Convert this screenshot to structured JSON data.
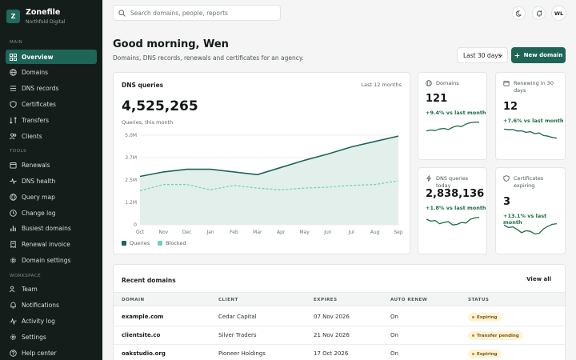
{
  "brand": {
    "logo": "Z",
    "name": "Zonefile",
    "org": "Northfold Digital"
  },
  "sidebar": {
    "sections": [
      {
        "title": "MAIN",
        "items": [
          {
            "label": "Overview",
            "icon": "grid-icon",
            "active": true
          },
          {
            "label": "Domains",
            "icon": "globe-icon"
          },
          {
            "label": "DNS records",
            "icon": "list-icon"
          },
          {
            "label": "Certificates",
            "icon": "shield-icon"
          },
          {
            "label": "Transfers",
            "icon": "transfer-icon"
          },
          {
            "label": "Clients",
            "icon": "users-icon"
          }
        ]
      },
      {
        "title": "TOOLS",
        "items": [
          {
            "label": "Renewals",
            "icon": "calendar-icon"
          },
          {
            "label": "DNS health",
            "icon": "pulse-icon"
          },
          {
            "label": "Query map",
            "icon": "globe-icon"
          },
          {
            "label": "Change log",
            "icon": "clock-icon"
          },
          {
            "label": "Busiest domains",
            "icon": "bars-icon"
          },
          {
            "label": "Renewal invoice",
            "icon": "receipt-icon"
          },
          {
            "label": "Domain settings",
            "icon": "gear-icon"
          }
        ]
      },
      {
        "title": "WORKSPACE",
        "items": [
          {
            "label": "Team",
            "icon": "users-icon"
          },
          {
            "label": "Notifications",
            "icon": "bell-icon"
          },
          {
            "label": "Activity log",
            "icon": "activity-icon"
          },
          {
            "label": "Settings",
            "icon": "gear-icon"
          },
          {
            "label": "Help center",
            "icon": "help-icon"
          }
        ]
      }
    ]
  },
  "header": {
    "search_placeholder": "Search domains, people, reports",
    "avatar_initials": "WL",
    "greeting": "Good morning, Wen",
    "subtitle": "Domains, DNS records, renewals and certificates for an agency.",
    "period": "Last 30 days",
    "new_button": "New domain"
  },
  "dns_card": {
    "title": "DNS queries",
    "range": "Last 12 months",
    "total": "4,525,265",
    "caption": "Queries, this month"
  },
  "chart_data": {
    "type": "area",
    "categories": [
      "Oct",
      "Nov",
      "Dec",
      "Jan",
      "Feb",
      "Mar",
      "Apr",
      "May",
      "Jun",
      "Jul",
      "Aug",
      "Sep"
    ],
    "yticks": [
      "0",
      "1.2M",
      "2.5M",
      "3.7M",
      "5.0M"
    ],
    "ylim": [
      0,
      5000000
    ],
    "series": [
      {
        "name": "Queries",
        "color": "#1e6558",
        "values": [
          2700000,
          2950000,
          3100000,
          3100000,
          2950000,
          2800000,
          3200000,
          3600000,
          3950000,
          4350000,
          4650000,
          4950000
        ]
      },
      {
        "name": "Blocked",
        "color": "#6fd3b6",
        "values": [
          1900000,
          2250000,
          2250000,
          1950000,
          2200000,
          2050000,
          1950000,
          2050000,
          2100000,
          2200000,
          2250000,
          2450000
        ]
      }
    ],
    "grid": true,
    "legend": "bottom-left"
  },
  "stats": [
    {
      "label": "Domains",
      "value": "121",
      "delta": "+9.4% vs last month",
      "icon": "globe-icon",
      "spark": [
        0.2,
        0.28,
        0.24,
        0.36,
        0.4,
        0.32,
        0.5,
        0.6,
        0.55,
        0.75,
        0.85,
        0.9,
        0.88
      ]
    },
    {
      "label": "Renewing in 30 days",
      "value": "12",
      "delta": "+7.6% vs last month",
      "icon": "calendar-icon",
      "spark": [
        0.85,
        0.8,
        0.82,
        0.7,
        0.72,
        0.6,
        0.65,
        0.5,
        0.55,
        0.35,
        0.3,
        0.2,
        0.15
      ]
    },
    {
      "label": "DNS queries today",
      "value": "2,838,136",
      "delta": "+1.8% vs last month",
      "icon": "bolt-icon",
      "spark": [
        0.75,
        0.6,
        0.65,
        0.4,
        0.5,
        0.55,
        0.3,
        0.35,
        0.5,
        0.45,
        0.75,
        0.85,
        0.9
      ]
    },
    {
      "label": "Certificates expiring",
      "value": "3",
      "delta": "+13.1% vs last month",
      "icon": "shield-icon",
      "spark": [
        0.8,
        0.6,
        0.65,
        0.45,
        0.2,
        0.35,
        0.3,
        0.1,
        0.15,
        0.5,
        0.7,
        0.85,
        0.9
      ]
    }
  ],
  "recent": {
    "title": "Recent domains",
    "view_all": "View all",
    "columns": [
      "DOMAIN",
      "CLIENT",
      "EXPIRES",
      "AUTO RENEW",
      "STATUS"
    ],
    "rows": [
      {
        "domain": "example.com",
        "client": "Cedar Capital",
        "expires": "07 Nov 2026",
        "auto_renew": "On",
        "status": "Expiring"
      },
      {
        "domain": "clientsite.co",
        "client": "Silver Traders",
        "expires": "21 Nov 2026",
        "auto_renew": "On",
        "status": "Transfer pending"
      },
      {
        "domain": "oakstudio.org",
        "client": "Pioneer Holdings",
        "expires": "17 Oct 2026",
        "auto_renew": "On",
        "status": "Expiring"
      }
    ]
  },
  "colors": {
    "accent": "#1e6558",
    "sidebar": "#151d1b",
    "positive": "#1b6c45",
    "warning_badge": "#fdf3d7"
  }
}
